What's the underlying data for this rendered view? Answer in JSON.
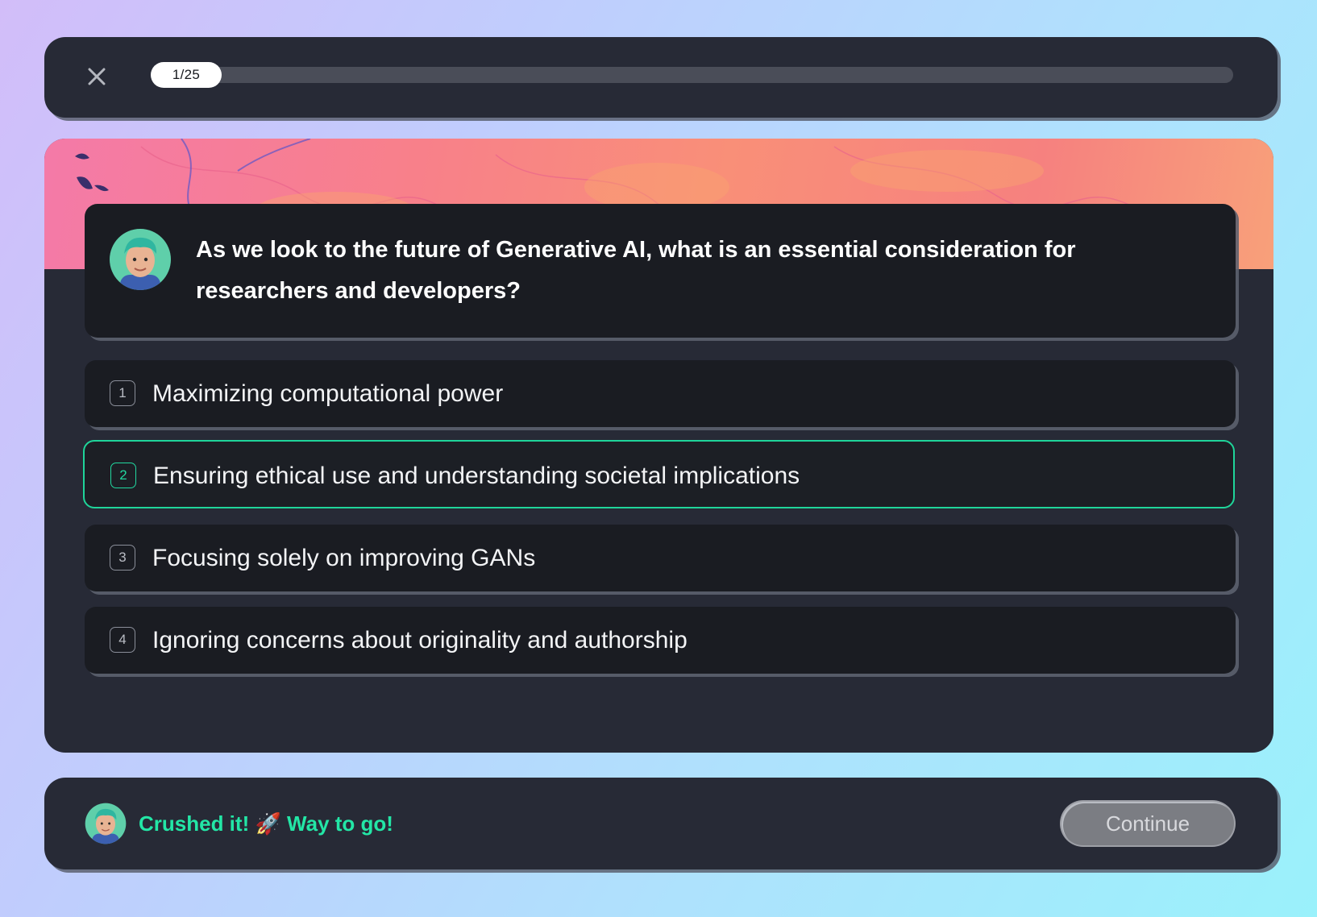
{
  "header": {
    "close_icon": "close-icon",
    "progress_label": "1/25",
    "progress_current": 1,
    "progress_total": 25
  },
  "question": {
    "avatar_icon": "avatar-icon",
    "text": "As we look to the future of Generative AI, what is an essential consideration for researchers and developers?"
  },
  "options": [
    {
      "number": "1",
      "label": "Maximizing computational power",
      "selected": false
    },
    {
      "number": "2",
      "label": "Ensuring ethical use and understanding societal implications",
      "selected": true
    },
    {
      "number": "3",
      "label": "Focusing solely on improving GANs",
      "selected": false
    },
    {
      "number": "4",
      "label": "Ignoring concerns about originality and authorship",
      "selected": false
    }
  ],
  "footer": {
    "feedback": "Crushed it! 🚀 Way to go!",
    "continue_label": "Continue"
  },
  "colors": {
    "accent_green": "#1fd59a",
    "card_bg": "#272a36",
    "box_bg": "#1a1c22",
    "banner_coral": "#f8808a"
  }
}
